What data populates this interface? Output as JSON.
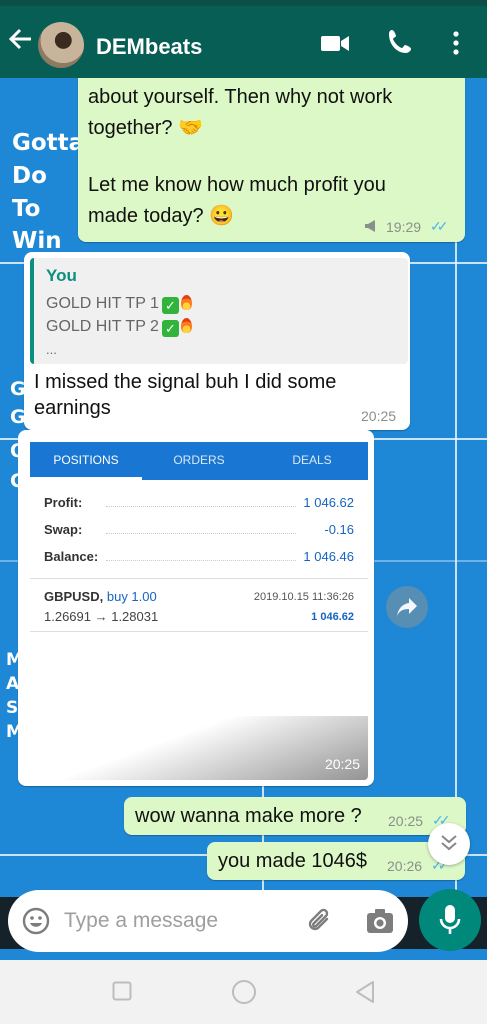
{
  "header": {
    "back_icon": "arrow-left-icon",
    "contact_name": "DEMbeats",
    "icons": [
      "video-call-icon",
      "phone-icon",
      "more-vert-icon"
    ],
    "color": "#075e54"
  },
  "wallpaper": {
    "text_top": [
      "Gotta",
      "Do",
      "To",
      "Win"
    ],
    "text_mid": [
      "G",
      "G",
      "O",
      "G"
    ],
    "text_low": [
      "M",
      "A",
      "S",
      "M"
    ]
  },
  "messages": [
    {
      "type": "outgoing",
      "lines": [
        "about yourself. Then why not work",
        "together? 🤝",
        "",
        "Let me know how much profit you",
        "made today? 😀"
      ],
      "time": "19:29",
      "status": "read"
    },
    {
      "type": "incoming",
      "quote": {
        "author": "You",
        "lines": [
          "GOLD HIT TP 1",
          "GOLD HIT TP 2",
          "..."
        ]
      },
      "text": "I missed the signal buh I did some earnings",
      "time": "20:25"
    },
    {
      "type": "incoming-image",
      "time": "20:25",
      "image": {
        "tabs": [
          "POSITIONS",
          "ORDERS",
          "DEALS"
        ],
        "summary": [
          {
            "label": "Profit:",
            "value": "1 046.62"
          },
          {
            "label": "Swap:",
            "value": "-0.16"
          },
          {
            "label": "Balance:",
            "value": "1 046.46"
          }
        ],
        "trade": {
          "symbol": "GBPUSD,",
          "side": "buy 1.00",
          "prices": "1.26691 → 1.28031",
          "datetime": "2019.10.15 11:36:26",
          "profit": "1 046.62"
        }
      }
    },
    {
      "type": "outgoing",
      "text": "wow wanna make more ?",
      "time": "20:25",
      "status": "read"
    },
    {
      "type": "outgoing",
      "text": "you made 1046$",
      "time": "20:26",
      "status": "read"
    }
  ],
  "input": {
    "placeholder": "Type a message",
    "icons": [
      "emoji-icon",
      "attach-icon",
      "camera-icon",
      "mic-icon"
    ]
  },
  "colors": {
    "outgoing_bubble": "#dcf8c6",
    "incoming_bubble": "#ffffff",
    "tick": "#4fb6ec",
    "mic_button": "#00897b",
    "wallpaper": "#1e88d6"
  }
}
